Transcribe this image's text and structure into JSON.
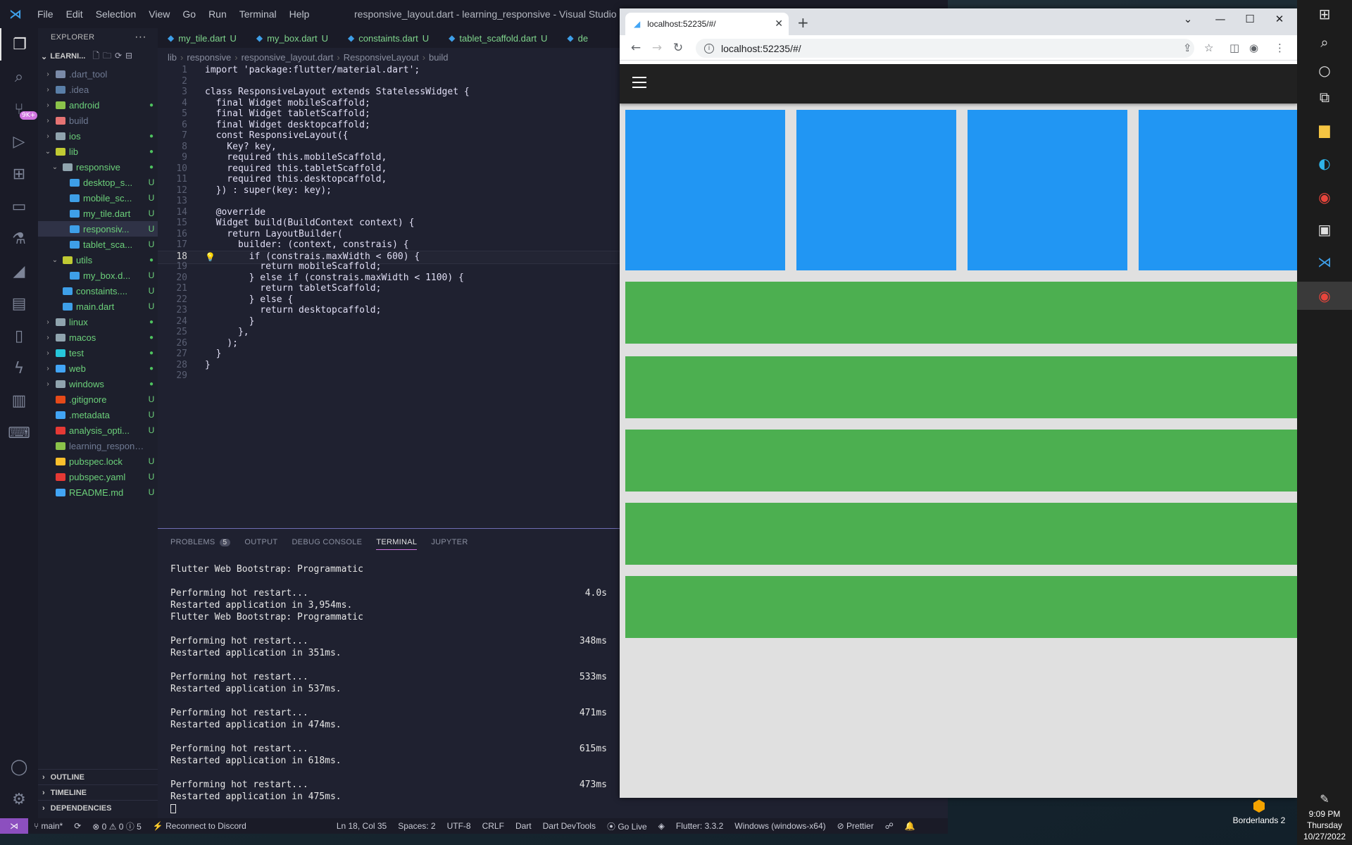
{
  "vscode": {
    "title": "responsive_layout.dart - learning_responsive - Visual Studio Code",
    "menu": [
      "File",
      "Edit",
      "Selection",
      "View",
      "Go",
      "Run",
      "Terminal",
      "Help"
    ],
    "activity_badge": "9K+",
    "explorer": {
      "header": "EXPLORER",
      "project": "LEARNI...",
      "items": [
        {
          "label": ".dart_tool",
          "deco": "",
          "color": "#6f7a93",
          "icon": "#7a8aa8",
          "chev": "›"
        },
        {
          "label": ".idea",
          "deco": "",
          "color": "#6f7a93",
          "icon": "#5a7fa8",
          "chev": "›"
        },
        {
          "label": "android",
          "deco": "●",
          "color": "#6cd07a",
          "icon": "#8bc34a",
          "chev": "›"
        },
        {
          "label": "build",
          "deco": "",
          "color": "#6f7a93",
          "icon": "#e57373",
          "chev": "›"
        },
        {
          "label": "ios",
          "deco": "●",
          "color": "#6cd07a",
          "icon": "#90a4ae",
          "chev": "›"
        },
        {
          "label": "lib",
          "deco": "●",
          "color": "#6cd07a",
          "icon": "#c0ca33",
          "chev": "⌄"
        },
        {
          "label": "responsive",
          "deco": "●",
          "color": "#6cd07a",
          "icon": "#90a4ae",
          "chev": "⌄"
        },
        {
          "label": "desktop_s...",
          "deco": "U",
          "color": "#6cd07a",
          "icon": "#3e9fe8",
          "chev": ""
        },
        {
          "label": "mobile_sc...",
          "deco": "U",
          "color": "#6cd07a",
          "icon": "#3e9fe8",
          "chev": ""
        },
        {
          "label": "my_tile.dart",
          "deco": "U",
          "color": "#6cd07a",
          "icon": "#3e9fe8",
          "chev": ""
        },
        {
          "label": "responsiv...",
          "deco": "U",
          "color": "#6cd07a",
          "icon": "#3e9fe8",
          "chev": ""
        },
        {
          "label": "tablet_sca...",
          "deco": "U",
          "color": "#6cd07a",
          "icon": "#3e9fe8",
          "chev": ""
        },
        {
          "label": "utils",
          "deco": "●",
          "color": "#6cd07a",
          "icon": "#c0ca33",
          "chev": "⌄"
        },
        {
          "label": "my_box.d...",
          "deco": "U",
          "color": "#6cd07a",
          "icon": "#3e9fe8",
          "chev": ""
        },
        {
          "label": "constaints....",
          "deco": "U",
          "color": "#6cd07a",
          "icon": "#3e9fe8",
          "chev": ""
        },
        {
          "label": "main.dart",
          "deco": "U",
          "color": "#6cd07a",
          "icon": "#3e9fe8",
          "chev": ""
        },
        {
          "label": "linux",
          "deco": "●",
          "color": "#6cd07a",
          "icon": "#90a4ae",
          "chev": "›"
        },
        {
          "label": "macos",
          "deco": "●",
          "color": "#6cd07a",
          "icon": "#90a4ae",
          "chev": "›"
        },
        {
          "label": "test",
          "deco": "●",
          "color": "#6cd07a",
          "icon": "#26c6da",
          "chev": "›"
        },
        {
          "label": "web",
          "deco": "●",
          "color": "#6cd07a",
          "icon": "#42a5f5",
          "chev": "›"
        },
        {
          "label": "windows",
          "deco": "●",
          "color": "#6cd07a",
          "icon": "#90a4ae",
          "chev": "›"
        },
        {
          "label": ".gitignore",
          "deco": "U",
          "color": "#6cd07a",
          "icon": "#e64a19",
          "chev": ""
        },
        {
          "label": ".metadata",
          "deco": "U",
          "color": "#6cd07a",
          "icon": "#42a5f5",
          "chev": ""
        },
        {
          "label": "analysis_opti...",
          "deco": "U",
          "color": "#6cd07a",
          "icon": "#e53935",
          "chev": ""
        },
        {
          "label": "learning_responsi...",
          "deco": "",
          "color": "#6f7a93",
          "icon": "#8bc34a",
          "chev": ""
        },
        {
          "label": "pubspec.lock",
          "deco": "U",
          "color": "#6cd07a",
          "icon": "#fbc02d",
          "chev": ""
        },
        {
          "label": "pubspec.yaml",
          "deco": "U",
          "color": "#6cd07a",
          "icon": "#e53935",
          "chev": ""
        },
        {
          "label": "README.md",
          "deco": "U",
          "color": "#6cd07a",
          "icon": "#42a5f5",
          "chev": ""
        }
      ],
      "sections": [
        "OUTLINE",
        "TIMELINE",
        "DEPENDENCIES"
      ]
    },
    "tabs": [
      {
        "label": "my_tile.dart",
        "status": "U"
      },
      {
        "label": "my_box.dart",
        "status": "U"
      },
      {
        "label": "constaints.dart",
        "status": "U"
      },
      {
        "label": "tablet_scaffold.dart",
        "status": "U"
      },
      {
        "label": "de",
        "status": ""
      }
    ],
    "breadcrumb": [
      "lib",
      "responsive",
      "responsive_layout.dart",
      "ResponsiveLayout",
      "build"
    ],
    "code": [
      "import 'package:flutter/material.dart';",
      "",
      "class ResponsiveLayout extends StatelessWidget {",
      "  final Widget mobileScaffold;",
      "  final Widget tabletScaffold;",
      "  final Widget desktopcaffold;",
      "  const ResponsiveLayout({",
      "    Key? key,",
      "    required this.mobileScaffold,",
      "    required this.tabletScaffold,",
      "    required this.desktopcaffold,",
      "  }) : super(key: key);",
      "",
      "  @override",
      "  Widget build(BuildContext context) {",
      "    return LayoutBuilder(",
      "      builder: (context, constrais) {",
      "        if (constrais.maxWidth < 600) {",
      "          return mobileScaffold;",
      "        } else if (constrais.maxWidth < 1100) {",
      "          return tabletScaffold;",
      "        } else {",
      "          return desktopcaffold;",
      "        }",
      "      },",
      "    );",
      "  }",
      "}",
      ""
    ],
    "current_line": 18,
    "panel": {
      "tabs": [
        "PROBLEMS",
        "OUTPUT",
        "DEBUG CONSOLE",
        "TERMINAL",
        "JUPYTER"
      ],
      "problems_count": "5",
      "active_tab": "TERMINAL",
      "terminal": [
        {
          "text": "Flutter Web Bootstrap: Programmatic",
          "time": ""
        },
        {
          "text": "",
          "time": ""
        },
        {
          "text": "Performing hot restart...",
          "time": "4.0s"
        },
        {
          "text": "Restarted application in 3,954ms.",
          "time": ""
        },
        {
          "text": "Flutter Web Bootstrap: Programmatic",
          "time": ""
        },
        {
          "text": "",
          "time": ""
        },
        {
          "text": "Performing hot restart...",
          "time": "348ms"
        },
        {
          "text": "Restarted application in 351ms.",
          "time": ""
        },
        {
          "text": "",
          "time": ""
        },
        {
          "text": "Performing hot restart...",
          "time": "533ms"
        },
        {
          "text": "Restarted application in 537ms.",
          "time": ""
        },
        {
          "text": "",
          "time": ""
        },
        {
          "text": "Performing hot restart...",
          "time": "471ms"
        },
        {
          "text": "Restarted application in 474ms.",
          "time": ""
        },
        {
          "text": "",
          "time": ""
        },
        {
          "text": "Performing hot restart...",
          "time": "615ms"
        },
        {
          "text": "Restarted application in 618ms.",
          "time": ""
        },
        {
          "text": "",
          "time": ""
        },
        {
          "text": "Performing hot restart...",
          "time": "473ms"
        },
        {
          "text": "Restarted application in 475ms.",
          "time": ""
        }
      ]
    },
    "statusbar": {
      "branch": "main*",
      "sync": "⟳",
      "problems": "⊗ 0 ⚠ 0 ⓘ 5",
      "discord": "Reconnect to Discord",
      "position": "Ln 18, Col 35",
      "spaces": "Spaces: 2",
      "encoding": "UTF-8",
      "eol": "CRLF",
      "language": "Dart",
      "devtools": "Dart DevTools",
      "golive": "Go Live",
      "flutter": "Flutter: 3.3.2",
      "device": "Windows (windows-x64)",
      "prettier": "Prettier"
    }
  },
  "chrome": {
    "tab_title": "localhost:52235/#/",
    "url": "localhost:52235/#/",
    "app": {
      "colors": {
        "appbar": "#212121",
        "box": "#2196f3",
        "tile": "#4caf50",
        "background": "#e0e0e0"
      },
      "box_count": 4,
      "tile_count": 5
    }
  },
  "taskbar": {
    "time": "9:09 PM",
    "day": "Thursday",
    "date": "10/27/2022",
    "shortcut_label": "Borderlands 2"
  }
}
